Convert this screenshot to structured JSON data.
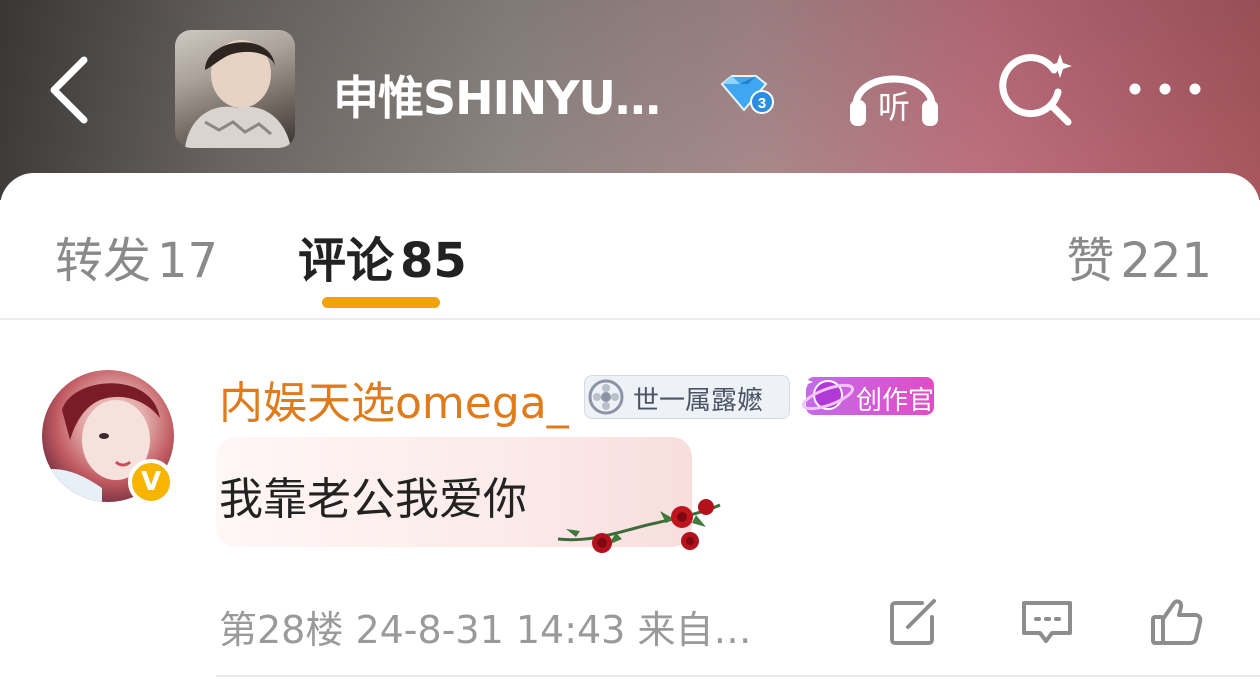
{
  "header": {
    "title": "申惟SHINYU…",
    "vip_level": "3",
    "listen_label": "听",
    "icons": [
      "back-arrow-icon",
      "vip-diamond-icon",
      "listen-headphones-icon",
      "search-sparkle-icon",
      "more-icon"
    ]
  },
  "tabs": [
    {
      "label": "转发",
      "count": "17"
    },
    {
      "label": "评论",
      "count": "85"
    },
    {
      "label": "赞",
      "count": "221"
    }
  ],
  "comment": {
    "username": "内娱天选omega_",
    "fan_badge": "世一属露嬷",
    "creator_badge": "创作官",
    "verified_badge": "V",
    "text": "我靠老公我爱你",
    "floor": "第28楼",
    "datetime": "24-8-31 14:43",
    "source": "来自…"
  },
  "colors": {
    "accent_orange": "#f2a20a",
    "username": "#e07b1b",
    "verify_badge": "#f7b500",
    "creator_badge": "#d159d8"
  }
}
